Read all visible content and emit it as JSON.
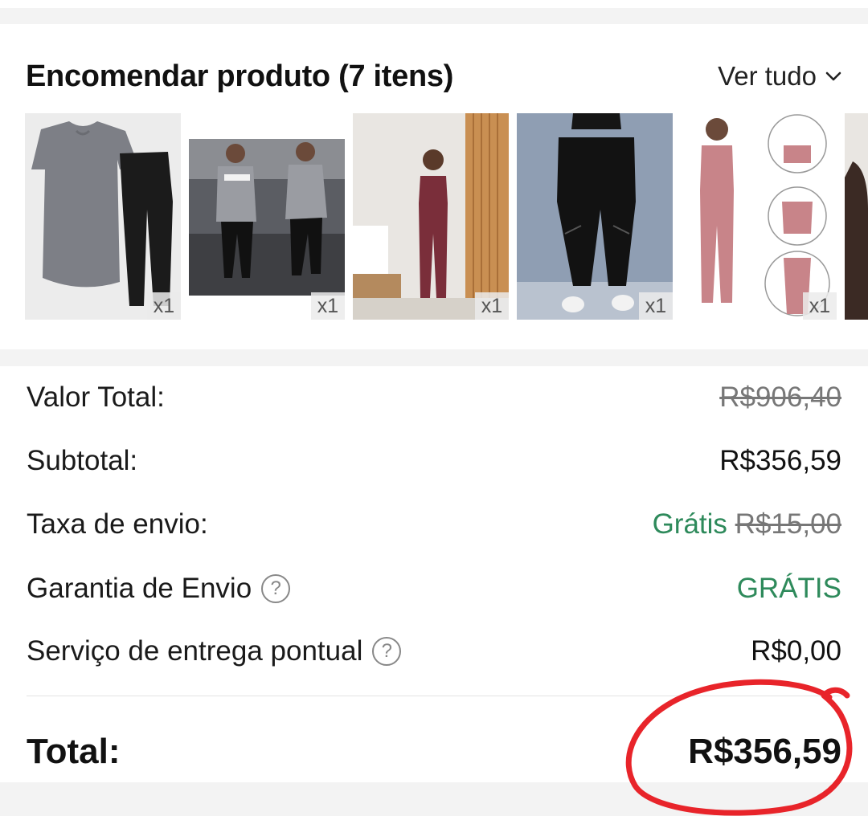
{
  "order": {
    "title": "Encomendar produto (7 itens)",
    "view_all_label": "Ver tudo",
    "products": [
      {
        "icon": "tshirt-and-leggings-photo",
        "qty": "x1"
      },
      {
        "icon": "gym-outfit-photo",
        "qty": "x1"
      },
      {
        "icon": "burgundy-set-photo",
        "qty": "x1"
      },
      {
        "icon": "black-leggings-photo",
        "qty": "x1"
      },
      {
        "icon": "pink-set-photo",
        "qty": "x1"
      }
    ]
  },
  "summary": {
    "valor_total": {
      "label": "Valor Total:",
      "value": "R$906,40"
    },
    "subtotal": {
      "label": "Subtotal:",
      "value": "R$356,59"
    },
    "taxa_envio": {
      "label": "Taxa de envio:",
      "free": "Grátis",
      "original": "R$15,00"
    },
    "garantia": {
      "label": "Garantia de Envio",
      "value": "GRÁTIS",
      "help": "?"
    },
    "servico": {
      "label": "Serviço de entrega pontual",
      "value": "R$0,00",
      "help": "?"
    },
    "total": {
      "label": "Total:",
      "value": "R$356,59"
    }
  },
  "colors": {
    "accent_green": "#2e8a5b",
    "annotation_red": "#e8242a"
  }
}
